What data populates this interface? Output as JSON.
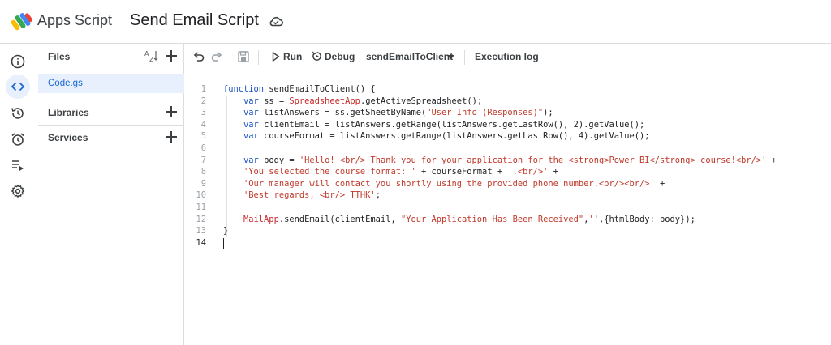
{
  "header": {
    "brand": "Apps Script",
    "project_title": "Send Email Script",
    "logo_icon": "apps-script-logo",
    "status_icon": "cloud-saved-icon"
  },
  "rail": {
    "items": [
      {
        "icon": "info-icon",
        "label": "Overview"
      },
      {
        "icon": "code-icon",
        "label": "Editor",
        "active": true
      },
      {
        "icon": "history-icon",
        "label": "Project History"
      },
      {
        "icon": "alarm-icon",
        "label": "Triggers"
      },
      {
        "icon": "executions-icon",
        "label": "Executions"
      },
      {
        "icon": "settings-icon",
        "label": "Project Settings"
      }
    ]
  },
  "files_panel": {
    "title": "Files",
    "files": [
      "Code.gs"
    ],
    "libraries_label": "Libraries",
    "services_label": "Services"
  },
  "toolbar": {
    "undo_icon": "undo-icon",
    "redo_icon": "redo-icon",
    "save_icon": "save-icon",
    "run_label": "Run",
    "debug_label": "Debug",
    "function_select": "sendEmailToClient",
    "execution_log_label": "Execution log"
  },
  "editor": {
    "current_line": 14,
    "lines": [
      "function sendEmailToClient() {",
      "    var ss = SpreadsheetApp.getActiveSpreadsheet();",
      "    var listAnswers = ss.getSheetByName(\"User Info (Responses)\");",
      "    var clientEmail = listAnswers.getRange(listAnswers.getLastRow(), 2).getValue();",
      "    var courseFormat = listAnswers.getRange(listAnswers.getLastRow(), 4).getValue();",
      "",
      "    var body = 'Hello! <br/> Thank you for your application for the <strong>Power BI</strong> course!<br/>' +",
      "    'You selected the course format: ' + courseFormat + '.<br/>' +",
      "    'Our manager will contact you shortly using the provided phone number.<br/><br/>' +",
      "    'Best regards, <br/> TTHK';",
      "",
      "    MailApp.sendEmail(clientEmail, \"Your Application Has Been Received\",'',{htmlBody: body});",
      "}",
      ""
    ]
  },
  "colors": {
    "accent": "#1967d2",
    "active_bg": "#e8f0fe",
    "keyword": "#1a52c4",
    "string": "#c0392b"
  }
}
